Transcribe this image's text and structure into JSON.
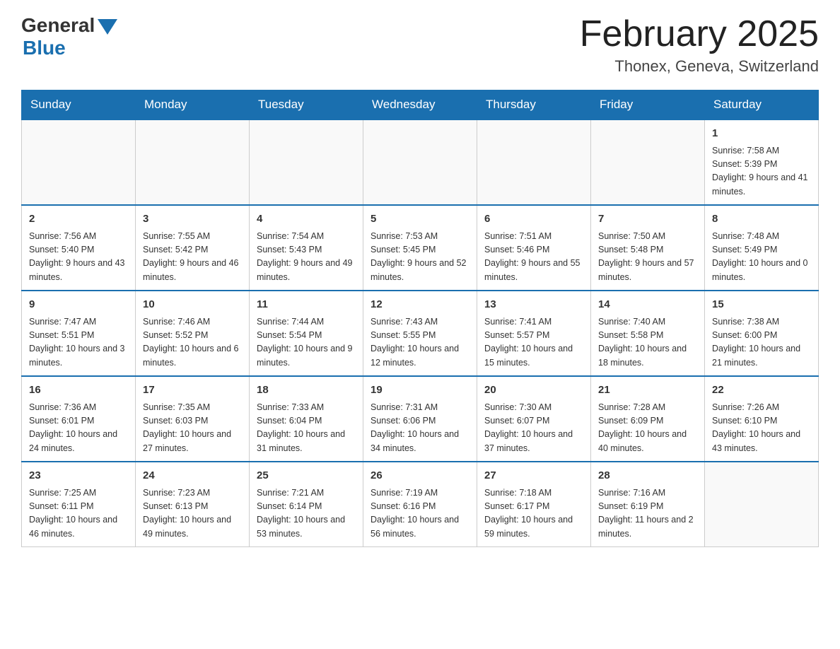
{
  "header": {
    "logo_general": "General",
    "logo_blue": "Blue",
    "title": "February 2025",
    "location": "Thonex, Geneva, Switzerland"
  },
  "days_of_week": [
    "Sunday",
    "Monday",
    "Tuesday",
    "Wednesday",
    "Thursday",
    "Friday",
    "Saturday"
  ],
  "weeks": [
    {
      "days": [
        {
          "number": "",
          "info": ""
        },
        {
          "number": "",
          "info": ""
        },
        {
          "number": "",
          "info": ""
        },
        {
          "number": "",
          "info": ""
        },
        {
          "number": "",
          "info": ""
        },
        {
          "number": "",
          "info": ""
        },
        {
          "number": "1",
          "info": "Sunrise: 7:58 AM\nSunset: 5:39 PM\nDaylight: 9 hours and 41 minutes."
        }
      ]
    },
    {
      "days": [
        {
          "number": "2",
          "info": "Sunrise: 7:56 AM\nSunset: 5:40 PM\nDaylight: 9 hours and 43 minutes."
        },
        {
          "number": "3",
          "info": "Sunrise: 7:55 AM\nSunset: 5:42 PM\nDaylight: 9 hours and 46 minutes."
        },
        {
          "number": "4",
          "info": "Sunrise: 7:54 AM\nSunset: 5:43 PM\nDaylight: 9 hours and 49 minutes."
        },
        {
          "number": "5",
          "info": "Sunrise: 7:53 AM\nSunset: 5:45 PM\nDaylight: 9 hours and 52 minutes."
        },
        {
          "number": "6",
          "info": "Sunrise: 7:51 AM\nSunset: 5:46 PM\nDaylight: 9 hours and 55 minutes."
        },
        {
          "number": "7",
          "info": "Sunrise: 7:50 AM\nSunset: 5:48 PM\nDaylight: 9 hours and 57 minutes."
        },
        {
          "number": "8",
          "info": "Sunrise: 7:48 AM\nSunset: 5:49 PM\nDaylight: 10 hours and 0 minutes."
        }
      ]
    },
    {
      "days": [
        {
          "number": "9",
          "info": "Sunrise: 7:47 AM\nSunset: 5:51 PM\nDaylight: 10 hours and 3 minutes."
        },
        {
          "number": "10",
          "info": "Sunrise: 7:46 AM\nSunset: 5:52 PM\nDaylight: 10 hours and 6 minutes."
        },
        {
          "number": "11",
          "info": "Sunrise: 7:44 AM\nSunset: 5:54 PM\nDaylight: 10 hours and 9 minutes."
        },
        {
          "number": "12",
          "info": "Sunrise: 7:43 AM\nSunset: 5:55 PM\nDaylight: 10 hours and 12 minutes."
        },
        {
          "number": "13",
          "info": "Sunrise: 7:41 AM\nSunset: 5:57 PM\nDaylight: 10 hours and 15 minutes."
        },
        {
          "number": "14",
          "info": "Sunrise: 7:40 AM\nSunset: 5:58 PM\nDaylight: 10 hours and 18 minutes."
        },
        {
          "number": "15",
          "info": "Sunrise: 7:38 AM\nSunset: 6:00 PM\nDaylight: 10 hours and 21 minutes."
        }
      ]
    },
    {
      "days": [
        {
          "number": "16",
          "info": "Sunrise: 7:36 AM\nSunset: 6:01 PM\nDaylight: 10 hours and 24 minutes."
        },
        {
          "number": "17",
          "info": "Sunrise: 7:35 AM\nSunset: 6:03 PM\nDaylight: 10 hours and 27 minutes."
        },
        {
          "number": "18",
          "info": "Sunrise: 7:33 AM\nSunset: 6:04 PM\nDaylight: 10 hours and 31 minutes."
        },
        {
          "number": "19",
          "info": "Sunrise: 7:31 AM\nSunset: 6:06 PM\nDaylight: 10 hours and 34 minutes."
        },
        {
          "number": "20",
          "info": "Sunrise: 7:30 AM\nSunset: 6:07 PM\nDaylight: 10 hours and 37 minutes."
        },
        {
          "number": "21",
          "info": "Sunrise: 7:28 AM\nSunset: 6:09 PM\nDaylight: 10 hours and 40 minutes."
        },
        {
          "number": "22",
          "info": "Sunrise: 7:26 AM\nSunset: 6:10 PM\nDaylight: 10 hours and 43 minutes."
        }
      ]
    },
    {
      "days": [
        {
          "number": "23",
          "info": "Sunrise: 7:25 AM\nSunset: 6:11 PM\nDaylight: 10 hours and 46 minutes."
        },
        {
          "number": "24",
          "info": "Sunrise: 7:23 AM\nSunset: 6:13 PM\nDaylight: 10 hours and 49 minutes."
        },
        {
          "number": "25",
          "info": "Sunrise: 7:21 AM\nSunset: 6:14 PM\nDaylight: 10 hours and 53 minutes."
        },
        {
          "number": "26",
          "info": "Sunrise: 7:19 AM\nSunset: 6:16 PM\nDaylight: 10 hours and 56 minutes."
        },
        {
          "number": "27",
          "info": "Sunrise: 7:18 AM\nSunset: 6:17 PM\nDaylight: 10 hours and 59 minutes."
        },
        {
          "number": "28",
          "info": "Sunrise: 7:16 AM\nSunset: 6:19 PM\nDaylight: 11 hours and 2 minutes."
        },
        {
          "number": "",
          "info": ""
        }
      ]
    }
  ]
}
